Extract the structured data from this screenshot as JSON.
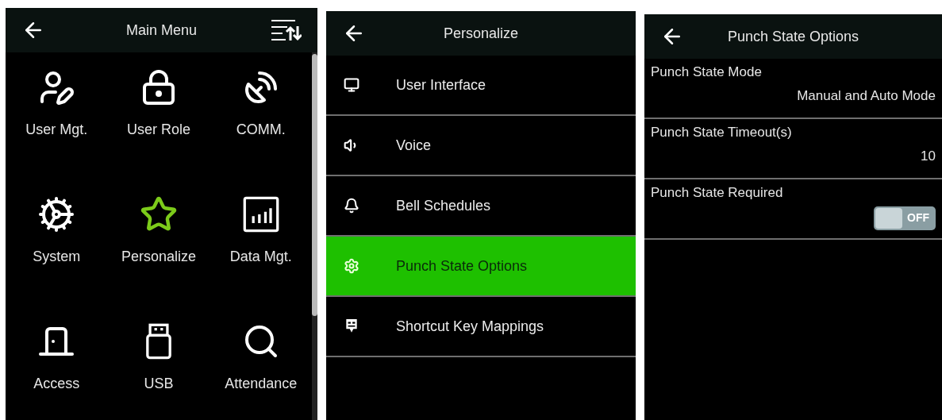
{
  "screens": [
    {
      "kind": "grid",
      "title": "Main Menu",
      "items": [
        {
          "label": "User Mgt.",
          "selected": false
        },
        {
          "label": "User Role",
          "selected": false
        },
        {
          "label": "COMM.",
          "selected": false
        },
        {
          "label": "System",
          "selected": false
        },
        {
          "label": "Personalize",
          "selected": true
        },
        {
          "label": "Data Mgt.",
          "selected": false
        },
        {
          "label": "Access",
          "selected": false
        },
        {
          "label": "USB",
          "selected": false
        },
        {
          "label": "Attendance",
          "selected": false
        }
      ]
    },
    {
      "kind": "list",
      "title": "Personalize",
      "items": [
        {
          "label": "User Interface",
          "selected": false
        },
        {
          "label": "Voice",
          "selected": false
        },
        {
          "label": "Bell Schedules",
          "selected": false
        },
        {
          "label": "Punch State Options",
          "selected": true
        },
        {
          "label": "Shortcut Key Mappings",
          "selected": false
        }
      ]
    },
    {
      "kind": "settings",
      "title": "Punch State Options",
      "items": [
        {
          "kind": "value",
          "label": "Punch State Mode",
          "value": "Manual and Auto Mode"
        },
        {
          "kind": "value",
          "label": "Punch State Timeout(s)",
          "value": "10"
        },
        {
          "kind": "toggle",
          "label": "Punch State Required",
          "on": false,
          "state_label": "OFF"
        }
      ]
    }
  ]
}
